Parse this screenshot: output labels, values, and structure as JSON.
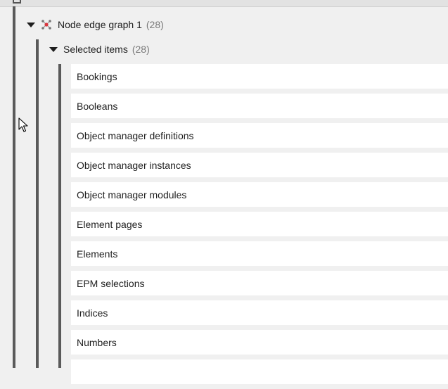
{
  "tree": {
    "root_node": {
      "label": "Node edge graph 1",
      "count": "(28)"
    },
    "child_node": {
      "label": "Selected items",
      "count": "(28)"
    },
    "items": [
      {
        "label": "Bookings"
      },
      {
        "label": "Booleans"
      },
      {
        "label": "Object manager definitions"
      },
      {
        "label": "Object manager instances"
      },
      {
        "label": "Object manager modules"
      },
      {
        "label": "Element pages"
      },
      {
        "label": "Elements"
      },
      {
        "label": "EPM selections"
      },
      {
        "label": "Indices"
      },
      {
        "label": "Numbers"
      },
      {
        "label": ""
      }
    ]
  },
  "icons": {
    "graph_icon_color": "#d9363e",
    "caret_icon": "caret-down-icon",
    "graph_icon": "node-edge-graph-icon",
    "cursor_icon": "mouse-pointer-icon"
  }
}
